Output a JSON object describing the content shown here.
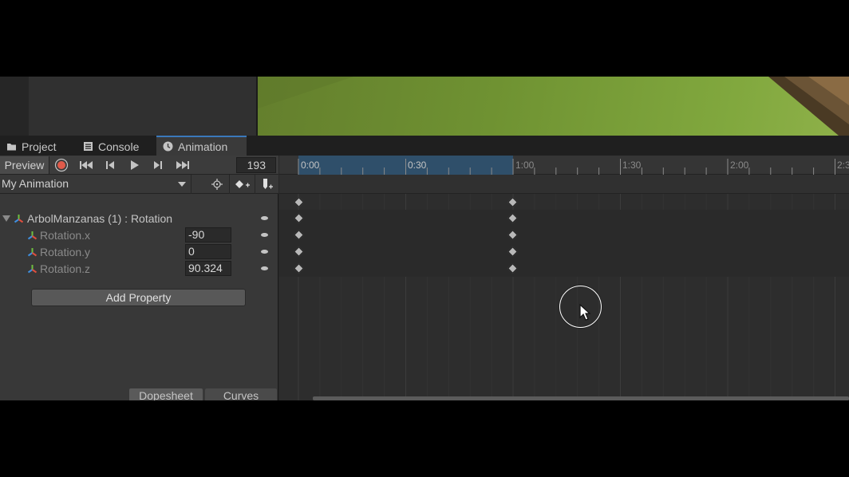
{
  "tabs": [
    {
      "label": "Project",
      "icon": "folder-icon"
    },
    {
      "label": "Console",
      "icon": "console-icon"
    },
    {
      "label": "Animation",
      "icon": "clock-icon"
    }
  ],
  "toolbar": {
    "preview_label": "Preview",
    "frame_value": "193"
  },
  "clip": {
    "name": "My Animation"
  },
  "properties": {
    "parent_label": "ArbolManzanas (1) : Rotation",
    "rows": [
      {
        "label": "Rotation.x",
        "value": "-90"
      },
      {
        "label": "Rotation.y",
        "value": "0"
      },
      {
        "label": "Rotation.z",
        "value": "90.324"
      }
    ]
  },
  "add_property_label": "Add Property",
  "modes": {
    "dopesheet": "Dopesheet",
    "curves": "Curves"
  },
  "timeline": {
    "labels": [
      "0:00",
      "0:30",
      "1:00",
      "1:30",
      "2:00",
      "2:3"
    ]
  },
  "colors": {
    "accent": "#3a79bb",
    "record": "#e05a4a",
    "range_highlight": "#2f4f6a"
  }
}
